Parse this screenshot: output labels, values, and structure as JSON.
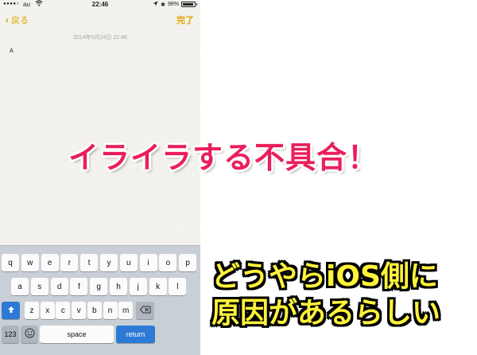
{
  "status_bar": {
    "signal": "●●●●○",
    "carrier": "au",
    "time": "22:46",
    "bluetooth": "✱",
    "battery_percent": "98%",
    "battery_level": 0.98,
    "icons": [
      "wifi-icon",
      "location-arrow-icon",
      "bluetooth-icon",
      "battery-icon"
    ]
  },
  "nav": {
    "back_label": "戻る",
    "done_label": "完了"
  },
  "note": {
    "date": "2014年9月24日 22:46",
    "body": "A"
  },
  "keyboard": {
    "rows": [
      [
        "q",
        "w",
        "e",
        "r",
        "t",
        "y",
        "u",
        "i",
        "o",
        "p"
      ],
      [
        "a",
        "s",
        "d",
        "f",
        "g",
        "h",
        "j",
        "k",
        "l"
      ],
      [
        "z",
        "x",
        "c",
        "v",
        "b",
        "n",
        "m"
      ]
    ],
    "shift_icon": "shift-arrow-icon",
    "delete_icon": "delete-backspace-icon",
    "numbers_label": "123",
    "globe_icon": "emoji-keyboard-icon",
    "space_label": "space",
    "return_label": "return"
  },
  "overlay": {
    "headline": "イライラする不具合！",
    "caption_line_1": "どうやらiOS側に",
    "caption_line_2": "原因があるらしい"
  },
  "colors": {
    "accent": "#e0a400",
    "headline": "#ea1f5c",
    "caption": "#fff33a",
    "keyboard_bg": "#c9cfd6",
    "blue_key": "#2c7ad6"
  }
}
